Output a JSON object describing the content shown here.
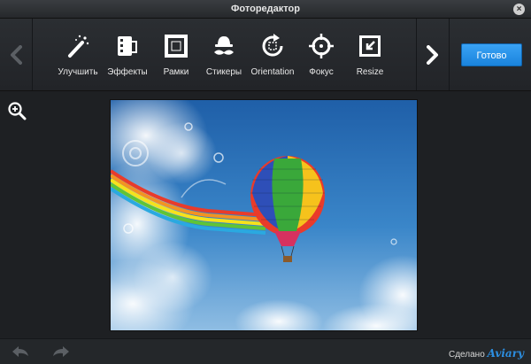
{
  "window": {
    "title": "Фоторедактор",
    "close_label": "×"
  },
  "toolbar": {
    "tools": [
      {
        "label": "Улучшить",
        "icon": "magic-wand-icon"
      },
      {
        "label": "Эффекты",
        "icon": "film-icon"
      },
      {
        "label": "Рамки",
        "icon": "frame-icon"
      },
      {
        "label": "Стикеры",
        "icon": "mustache-hat-icon"
      },
      {
        "label": "Orientation",
        "icon": "rotate-icon"
      },
      {
        "label": "Фокус",
        "icon": "focus-crosshair-icon"
      },
      {
        "label": "Resize",
        "icon": "resize-icon"
      }
    ],
    "done_label": "Готово"
  },
  "footer": {
    "credit_prefix": "Сделано",
    "credit_brand": "Aviary"
  },
  "colors": {
    "accent": "#2a94ec",
    "background": "#1e2023",
    "sky": "#2b6fb3"
  }
}
